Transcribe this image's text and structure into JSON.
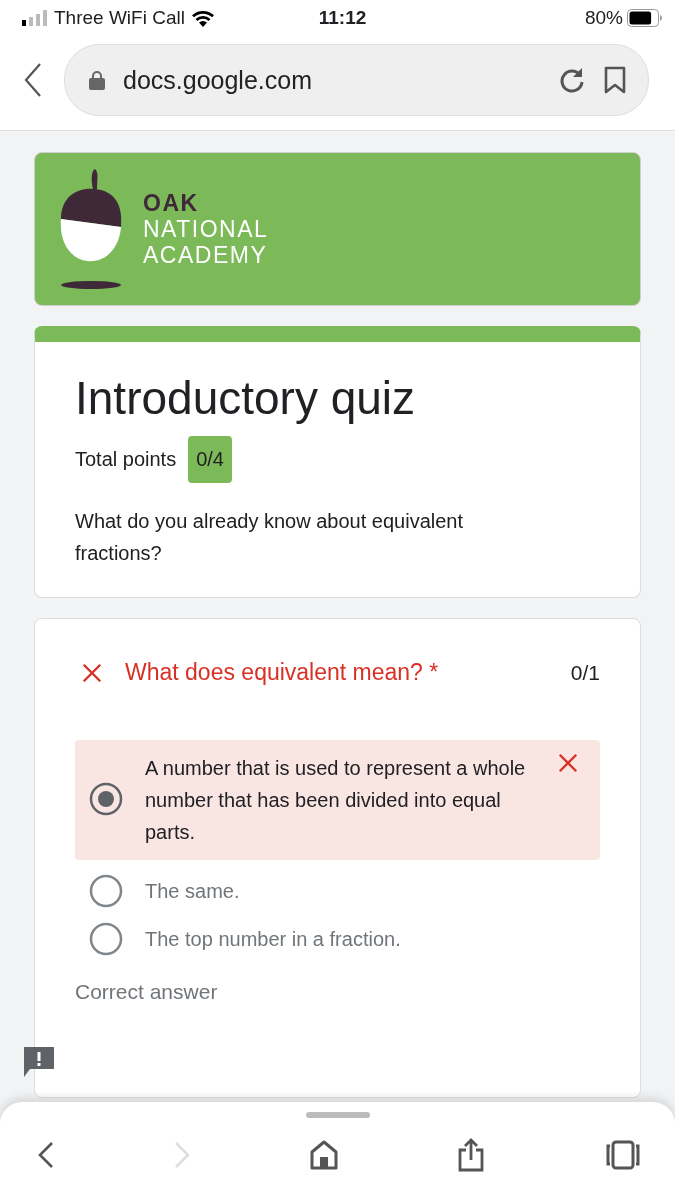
{
  "status_bar": {
    "carrier": "Three WiFi Call",
    "time": "11:12",
    "battery": "80%"
  },
  "address_bar": {
    "url": "docs.google.com"
  },
  "header": {
    "logo_lines": [
      "OAK",
      "NATIONAL",
      "ACADEMY"
    ]
  },
  "quiz": {
    "title": "Introductory quiz",
    "points_label": "Total points",
    "points": "0/4",
    "description": "What do you already know about equivalent fractions?"
  },
  "question": {
    "text": "What does equivalent mean?",
    "required_mark": "*",
    "score": "0/1",
    "correct": false,
    "options": [
      {
        "text": "A number that is used to represent a whole number that has been divided into equal parts.",
        "selected": true
      },
      {
        "text": "The same.",
        "selected": false
      },
      {
        "text": "The top number in a fraction.",
        "selected": false
      }
    ],
    "correct_answer_label": "Correct answer"
  },
  "bottom_toolbar": {
    "forward_disabled": true
  }
}
